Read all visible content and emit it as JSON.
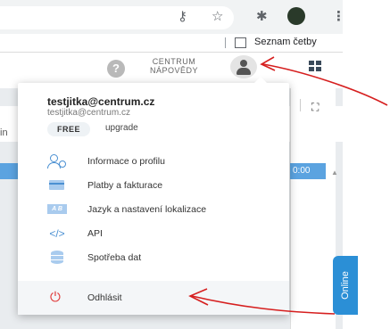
{
  "browser": {
    "icons": {
      "key": "key-icon",
      "star": "star-icon",
      "extensions": "puzzle-icon",
      "profile": "profile-avatar-icon",
      "menu": "kebab-menu-icon"
    },
    "reading_list_label": "Seznam četby"
  },
  "header": {
    "help_line1": "CENTRUM",
    "help_line2": "NÁPOVĚDY",
    "help_icon": "question-circle-icon",
    "avatar_icon": "user-avatar-icon",
    "apps_icon": "apps-grid-icon"
  },
  "background": {
    "left_text": "in",
    "time_text": "0:00",
    "online_label": "Online"
  },
  "user_menu": {
    "email": "testjitka@centrum.cz",
    "email_secondary": "testjitka@centrum.cz",
    "plan_badge": "FREE",
    "upgrade_label": "upgrade",
    "items": [
      {
        "label": "Informace o profilu",
        "icon": "profile-icon"
      },
      {
        "label": "Platby a fakturace",
        "icon": "credit-card-icon"
      },
      {
        "label": "Jazyk a nastavení lokalizace",
        "icon": "language-icon"
      },
      {
        "label": "API",
        "icon": "code-icon"
      },
      {
        "label": "Spotřeba dat",
        "icon": "database-icon"
      }
    ],
    "logout_label": "Odhlásit",
    "logout_icon": "power-icon"
  },
  "colors": {
    "accent": "#4b90d2",
    "danger": "#e03c3c",
    "online_tab": "#2b8fd6",
    "annotation": "#d61f1f"
  }
}
